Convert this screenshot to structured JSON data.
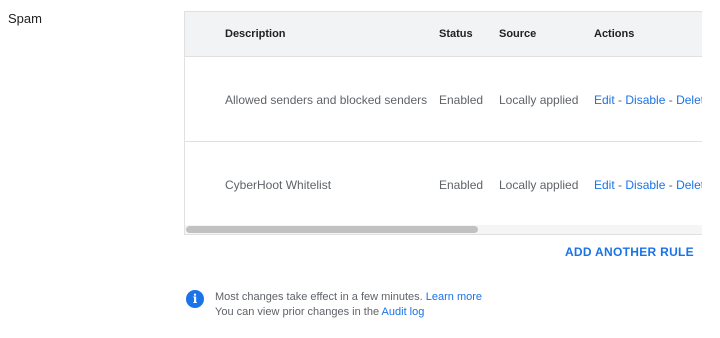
{
  "section": {
    "label": "Spam"
  },
  "table": {
    "headers": {
      "description": "Description",
      "status": "Status",
      "source": "Source",
      "actions": "Actions"
    },
    "rows": [
      {
        "description": "Allowed senders and blocked senders",
        "status": "Enabled",
        "source": "Locally applied",
        "actions": {
          "edit": "Edit",
          "disable": "Disable",
          "delete": "Delete",
          "separator": " - "
        }
      },
      {
        "description": "CyberHoot Whitelist",
        "status": "Enabled",
        "source": "Locally applied",
        "actions": {
          "edit": "Edit",
          "disable": "Disable",
          "delete": "Delete",
          "separator": " - "
        }
      }
    ]
  },
  "add_rule": {
    "label": "ADD ANOTHER RULE"
  },
  "info": {
    "icon": "info-icon",
    "line1_text": "Most changes take effect in a few minutes.",
    "line1_link": "Learn more",
    "line2_text": "You can view prior changes in the",
    "line2_link": "Audit log"
  },
  "colors": {
    "link": "#1a73e8",
    "header_bg": "#f1f3f4",
    "text_secondary": "#5f6368"
  }
}
